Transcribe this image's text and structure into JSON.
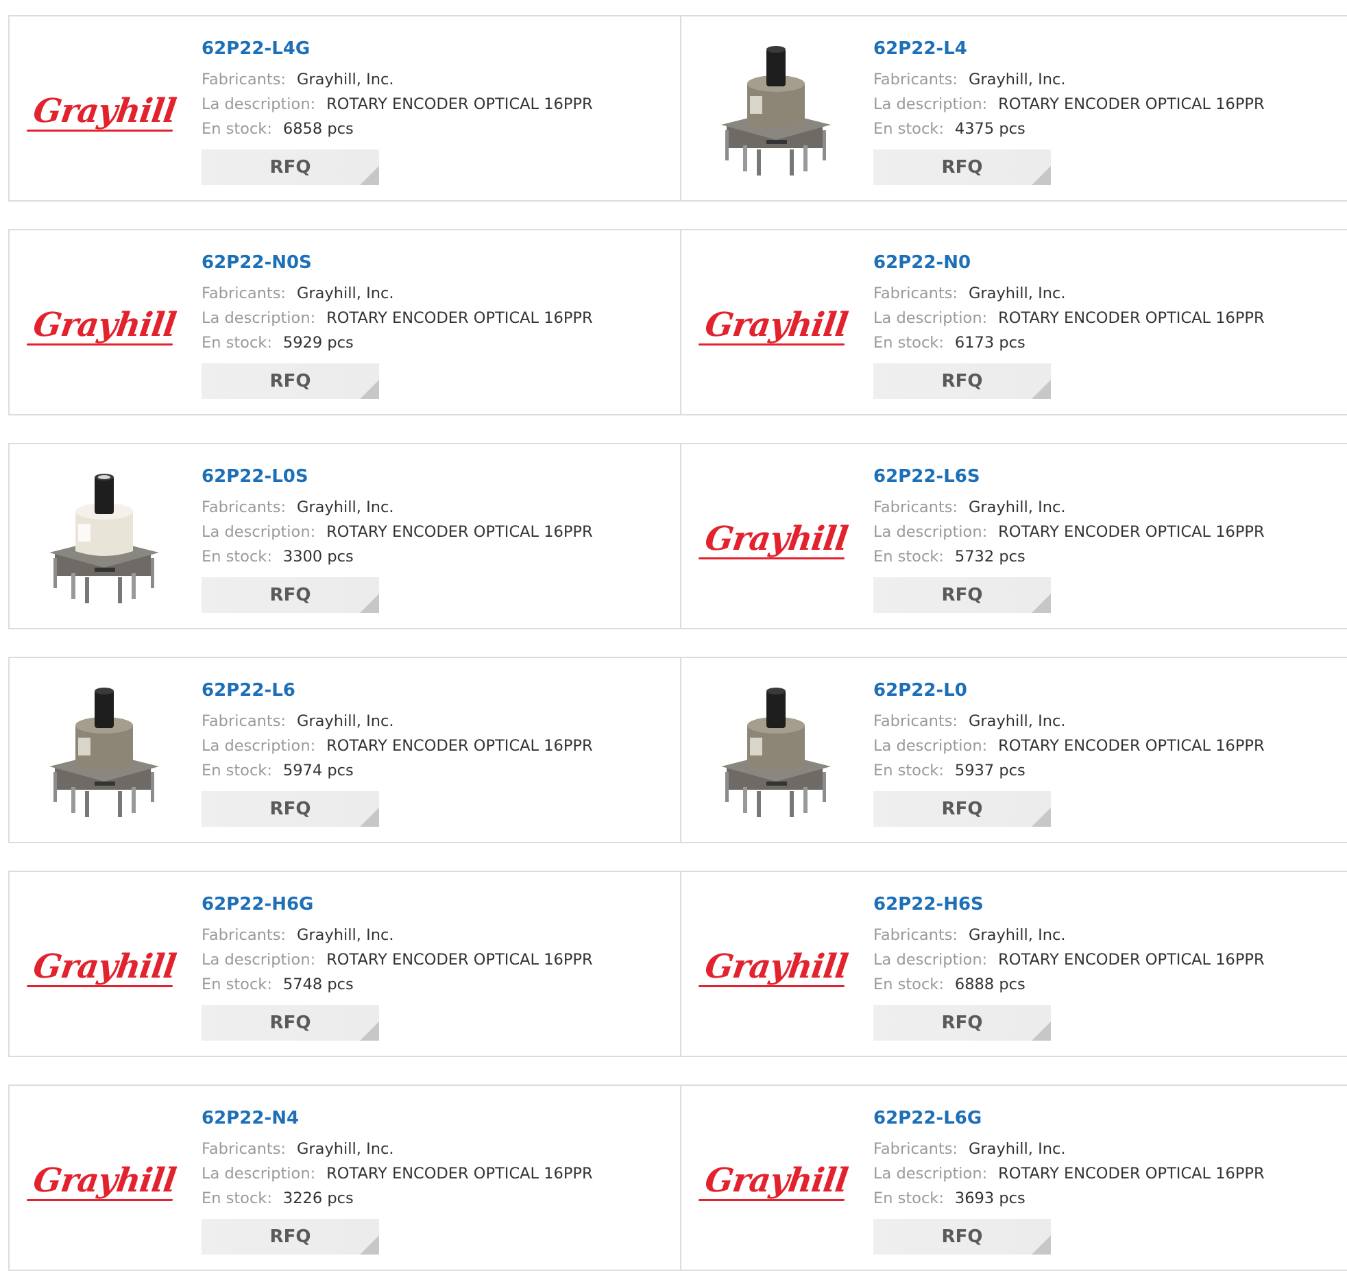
{
  "labels": {
    "manufacturer": "Fabricants:",
    "description": "La description:",
    "stock": "En stock:",
    "rfq": "RFQ"
  },
  "colors": {
    "link": "#1d6fb8",
    "brand_red": "#e2232e"
  },
  "products": [
    {
      "part": "62P22-L4G",
      "manufacturer": "Grayhill, Inc.",
      "description": "ROTARY ENCODER OPTICAL 16PPR",
      "stock": "6858 pcs",
      "image": "grayhill-logo",
      "logo_text": "Grayhill"
    },
    {
      "part": "62P22-L4",
      "manufacturer": "Grayhill, Inc.",
      "description": "ROTARY ENCODER OPTICAL 16PPR",
      "stock": "4375 pcs",
      "image": "encoder-photo-dark"
    },
    {
      "part": "62P22-N0S",
      "manufacturer": "Grayhill, Inc.",
      "description": "ROTARY ENCODER OPTICAL 16PPR",
      "stock": "5929 pcs",
      "image": "grayhill-logo",
      "logo_text": "Grayhill"
    },
    {
      "part": "62P22-N0",
      "manufacturer": "Grayhill, Inc.",
      "description": "ROTARY ENCODER OPTICAL 16PPR",
      "stock": "6173 pcs",
      "image": "grayhill-logo",
      "logo_text": "Grayhill"
    },
    {
      "part": "62P22-L0S",
      "manufacturer": "Grayhill, Inc.",
      "description": "ROTARY ENCODER OPTICAL 16PPR",
      "stock": "3300 pcs",
      "image": "encoder-photo-light"
    },
    {
      "part": "62P22-L6S",
      "manufacturer": "Grayhill, Inc.",
      "description": "ROTARY ENCODER OPTICAL 16PPR",
      "stock": "5732 pcs",
      "image": "grayhill-logo",
      "logo_text": "Grayhill"
    },
    {
      "part": "62P22-L6",
      "manufacturer": "Grayhill, Inc.",
      "description": "ROTARY ENCODER OPTICAL 16PPR",
      "stock": "5974 pcs",
      "image": "encoder-photo-dark"
    },
    {
      "part": "62P22-L0",
      "manufacturer": "Grayhill, Inc.",
      "description": "ROTARY ENCODER OPTICAL 16PPR",
      "stock": "5937 pcs",
      "image": "encoder-photo-dark"
    },
    {
      "part": "62P22-H6G",
      "manufacturer": "Grayhill, Inc.",
      "description": "ROTARY ENCODER OPTICAL 16PPR",
      "stock": "5748 pcs",
      "image": "grayhill-logo",
      "logo_text": "Grayhill"
    },
    {
      "part": "62P22-H6S",
      "manufacturer": "Grayhill, Inc.",
      "description": "ROTARY ENCODER OPTICAL 16PPR",
      "stock": "6888 pcs",
      "image": "grayhill-logo",
      "logo_text": "Grayhill"
    },
    {
      "part": "62P22-N4",
      "manufacturer": "Grayhill, Inc.",
      "description": "ROTARY ENCODER OPTICAL 16PPR",
      "stock": "3226 pcs",
      "image": "grayhill-logo",
      "logo_text": "Grayhill"
    },
    {
      "part": "62P22-L6G",
      "manufacturer": "Grayhill, Inc.",
      "description": "ROTARY ENCODER OPTICAL 16PPR",
      "stock": "3693 pcs",
      "image": "grayhill-logo",
      "logo_text": "Grayhill"
    }
  ]
}
